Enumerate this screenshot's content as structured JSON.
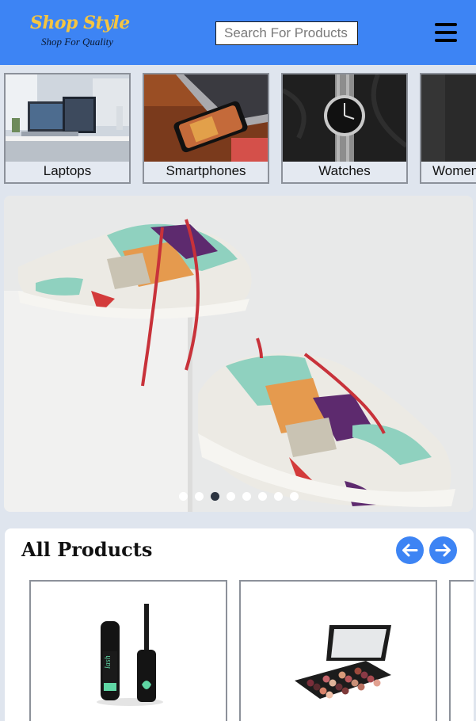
{
  "header": {
    "brand_title": "Shop Style",
    "brand_subtitle": "Shop For Quality",
    "search_placeholder": "Search For Products",
    "menu_icon": "hamburger-menu-icon"
  },
  "categories": [
    {
      "label": "Laptops"
    },
    {
      "label": "Smartphones"
    },
    {
      "label": "Watches"
    },
    {
      "label": "Women"
    }
  ],
  "carousel": {
    "slide_count": 8,
    "active_index": 2
  },
  "products_section": {
    "title": "All Products",
    "prev_icon": "arrow-left-icon",
    "next_icon": "arrow-right-icon"
  },
  "colors": {
    "header_bg": "#3d84f4",
    "brand_yellow": "#f4c542",
    "page_bg": "#dfe5ee",
    "accent": "#3d84f4"
  }
}
